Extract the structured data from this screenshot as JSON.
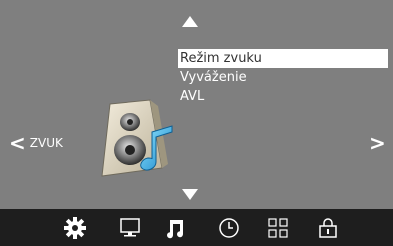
{
  "menu": {
    "items": [
      {
        "label": "Režim zvuku",
        "selected": true
      },
      {
        "label": "Vyváženie",
        "selected": false
      },
      {
        "label": "AVL",
        "selected": false
      }
    ]
  },
  "nav": {
    "left_label": "ZVUK",
    "left_glyph": "<",
    "right_glyph": ">"
  },
  "bottom_bar": {
    "icons": [
      "gear-icon",
      "monitor-icon",
      "music-note-icon",
      "clock-icon",
      "grid-icon",
      "lock-icon"
    ],
    "active": "music-note-icon"
  },
  "colors": {
    "background": "#7f7f7f",
    "bar": "#1e1e1e",
    "highlight": "#ffffff",
    "text": "#ffffff"
  }
}
